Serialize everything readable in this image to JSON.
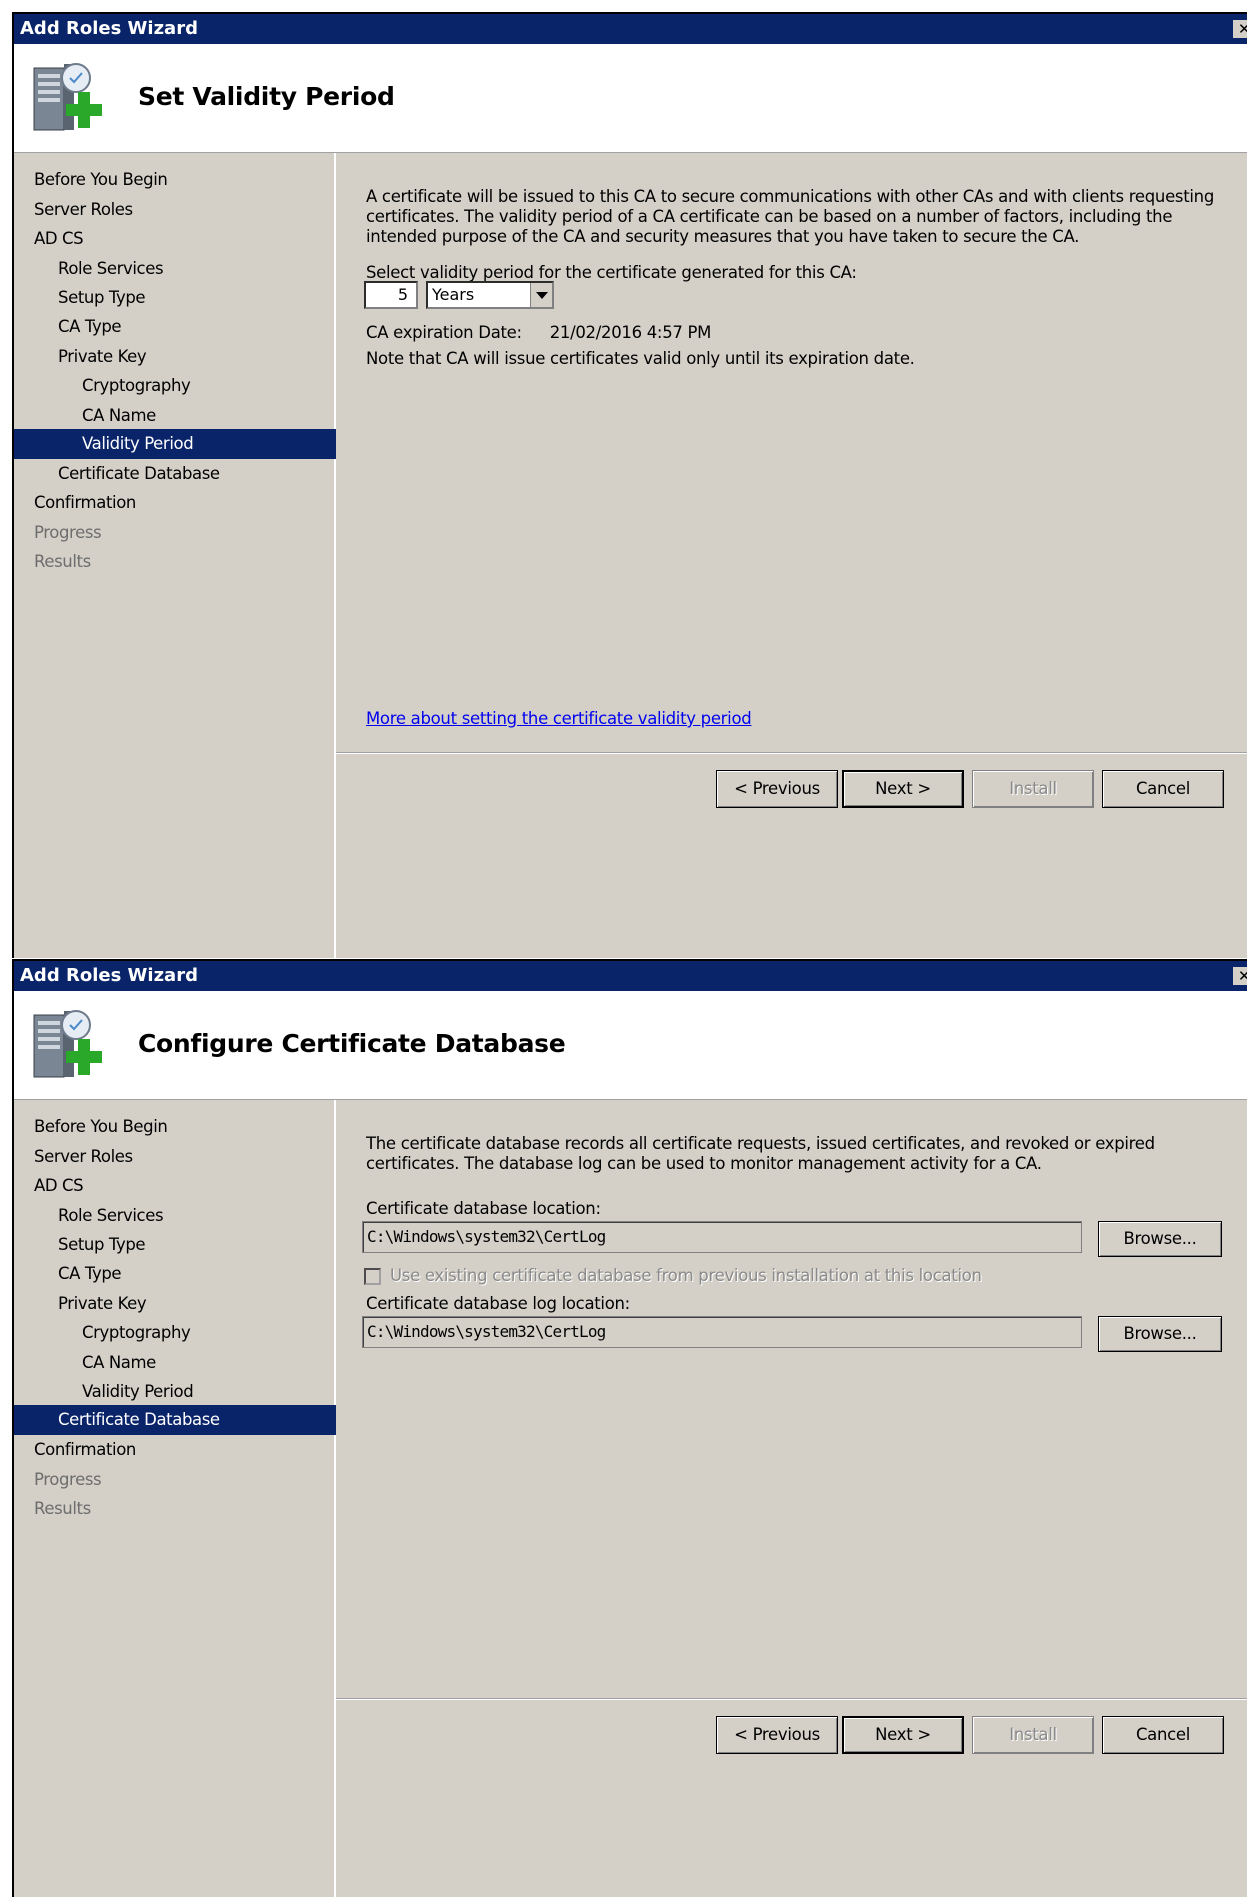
{
  "validity_window": {
    "title": "Add Roles Wizard",
    "close_glyph": "✕",
    "page_title": "Set Validity Period",
    "nav": [
      {
        "label": "Before You Begin"
      },
      {
        "label": "Server Roles"
      },
      {
        "label": "AD CS"
      },
      {
        "label": "Role Services"
      },
      {
        "label": "Setup Type"
      },
      {
        "label": "CA Type"
      },
      {
        "label": "Private Key"
      },
      {
        "label": "Cryptography"
      },
      {
        "label": "CA Name"
      },
      {
        "label": "Validity Period"
      },
      {
        "label": "Certificate Database"
      },
      {
        "label": "Confirmation"
      },
      {
        "label": "Progress"
      },
      {
        "label": "Results"
      }
    ],
    "description": "A certificate will be issued to this CA to secure communications with other CAs and with clients requesting certificates. The validity period of a CA certificate can be based on a number of factors, including the intended purpose of the CA and security measures that you have taken to secure the CA.",
    "select_label": "Select validity period for the certificate generated for this CA:",
    "period_value": "5",
    "period_unit": "Years",
    "expiration_label": "CA expiration Date:",
    "expiration_value": "21/02/2016 4:57 PM",
    "note": "Note that CA will issue certificates valid only until its expiration date.",
    "help_link": "More about setting the certificate validity period",
    "buttons": {
      "previous": "< Previous",
      "next": "Next >",
      "install": "Install",
      "cancel": "Cancel"
    }
  },
  "database_window": {
    "title": "Add Roles Wizard",
    "close_glyph": "✕",
    "page_title": "Configure Certificate Database",
    "nav": [
      {
        "label": "Before You Begin"
      },
      {
        "label": "Server Roles"
      },
      {
        "label": "AD CS"
      },
      {
        "label": "Role Services"
      },
      {
        "label": "Setup Type"
      },
      {
        "label": "CA Type"
      },
      {
        "label": "Private Key"
      },
      {
        "label": "Cryptography"
      },
      {
        "label": "CA Name"
      },
      {
        "label": "Validity Period"
      },
      {
        "label": "Certificate Database"
      },
      {
        "label": "Confirmation"
      },
      {
        "label": "Progress"
      },
      {
        "label": "Results"
      }
    ],
    "description": "The certificate database records all certificate requests, issued certificates, and revoked or expired certificates. The database log can be used to monitor management activity for a CA.",
    "db_location_label": "Certificate database location:",
    "db_location_value": "C:\\Windows\\system32\\CertLog",
    "browse_label": "Browse...",
    "use_existing_label": "Use existing certificate database from previous installation at this location",
    "log_location_label": "Certificate database log location:",
    "log_location_value": "C:\\Windows\\system32\\CertLog",
    "buttons": {
      "previous": "< Previous",
      "next": "Next >",
      "install": "Install",
      "cancel": "Cancel"
    }
  }
}
